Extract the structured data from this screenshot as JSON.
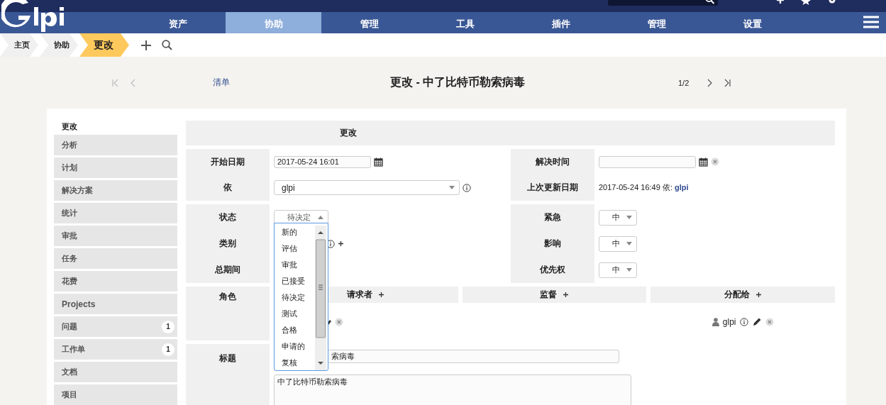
{
  "menu": {
    "items": [
      {
        "label": "资产",
        "selected": false
      },
      {
        "label": "协助",
        "selected": true
      },
      {
        "label": "管理",
        "selected": false
      },
      {
        "label": "工具",
        "selected": false
      },
      {
        "label": "插件",
        "selected": false
      },
      {
        "label": "管理",
        "selected": false
      },
      {
        "label": "设置",
        "selected": false
      }
    ]
  },
  "breadcrumb": {
    "items": [
      {
        "label": "主页",
        "selected": false
      },
      {
        "label": "协助",
        "selected": false
      },
      {
        "label": "更改",
        "selected": true
      }
    ]
  },
  "record_nav": {
    "list_link": "清单",
    "title": "更改 - 中了比特币勒索病毒",
    "position": "1/2"
  },
  "sidebar": {
    "items": [
      {
        "label": "更改",
        "selected": true
      },
      {
        "label": "分析",
        "selected": false
      },
      {
        "label": "计划",
        "selected": false
      },
      {
        "label": "解决方案",
        "selected": false
      },
      {
        "label": "统计",
        "selected": false
      },
      {
        "label": "审批",
        "selected": false
      },
      {
        "label": "任务",
        "selected": false
      },
      {
        "label": "花费",
        "selected": false
      },
      {
        "label": "Projects",
        "selected": false
      },
      {
        "label": "问题",
        "selected": false,
        "badge": "1"
      },
      {
        "label": "工作单",
        "selected": false,
        "badge": "1"
      },
      {
        "label": "文档",
        "selected": false
      },
      {
        "label": "项目",
        "selected": false
      }
    ]
  },
  "form": {
    "heading": "更改",
    "start_date": {
      "label": "开始日期",
      "value": "2017-05-24 16:01"
    },
    "resolution_time": {
      "label": "解决时间"
    },
    "by": {
      "label": "依",
      "value": "glpi"
    },
    "last_update": {
      "label": "上次更新日期",
      "text": "2017-05-24 16:49 依:",
      "user": "glpi"
    },
    "status": {
      "label": "状态",
      "value": "待决定",
      "expanded": true,
      "options": [
        "新的",
        "评估",
        "审批",
        "已接受",
        "待决定",
        "测试",
        "合格",
        "申请的",
        "复核"
      ]
    },
    "urgency": {
      "label": "紧急",
      "value": "中"
    },
    "category": {
      "label": "类别"
    },
    "impact": {
      "label": "影响",
      "value": "中"
    },
    "total_duration": {
      "label": "总期间"
    },
    "priority": {
      "label": "优先权",
      "value": "中"
    },
    "actors": {
      "label": "角色",
      "columns": [
        {
          "label": "请求者"
        },
        {
          "label": "监督"
        },
        {
          "label": "分配给",
          "user": "glpi"
        }
      ]
    },
    "title": {
      "label": "标题",
      "value": "索病毒"
    },
    "description": {
      "value": "中了比特币勒索病毒"
    }
  }
}
